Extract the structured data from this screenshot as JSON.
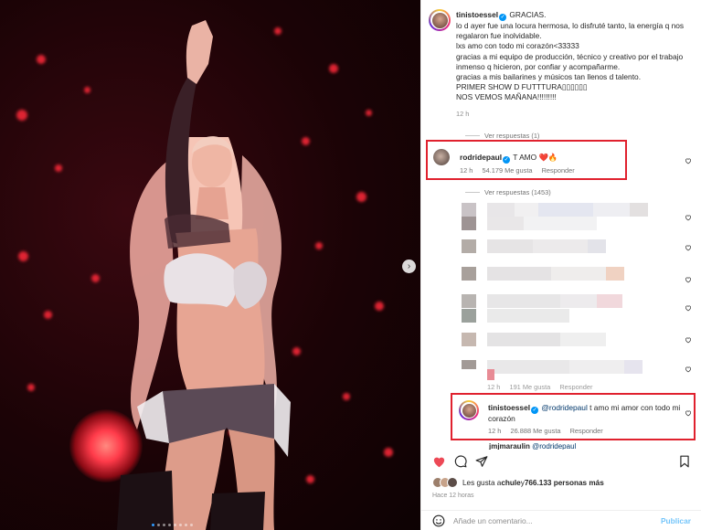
{
  "post": {
    "author": "tinistoessel",
    "verified": true,
    "caption_head": "GRACIAS.",
    "caption_lines": [
      "lo d ayer fue una locura hermosa, lo disfruté tanto, la energía q nos regalaron fue inolvidable.",
      "lxs amo con todo mi corazón<33333",
      "gracias a mi equipo de producción, técnico y creativo por el trabajo inmenso q hicieron, por confiar y acompañarme.",
      "gracias a mis bailarines y músicos tan llenos d talento.",
      "PRIMER SHOW D FUTTTURA▯▯▯▯▯▯",
      "NOS VEMOS MAÑANA!!!!!!!!!"
    ],
    "time": "12 h"
  },
  "comments": {
    "view_replies_1": "Ver respuestas (1)",
    "highlight_1": {
      "user": "rodridepaul",
      "text": "T AMO ❤️🔥",
      "time": "12 h",
      "likes": "54.179 Me gusta",
      "reply": "Responder"
    },
    "view_replies_2": "Ver respuestas (1453)",
    "partial_meta": {
      "time": "12 h",
      "likes": "191 Me gusta",
      "reply": "Responder"
    },
    "highlight_2": {
      "user": "tinistoessel",
      "mention": "@rodridepaul",
      "text": " t amo mi amor con todo mi corazón",
      "time": "12 h",
      "likes": "26.888 Me gusta",
      "reply": "Responder"
    },
    "partial_next": {
      "user": "jmjmaraulin",
      "mention": "@rodridepaul"
    }
  },
  "likes_summary": {
    "prefix": "Les gusta a ",
    "user": "chule",
    "middle": " y ",
    "count": "766.133 personas más"
  },
  "posted_ago": "Hace 12 horas",
  "comment_input": {
    "placeholder": "Añade un comentario..."
  },
  "publish_label": "Publicar",
  "colors": {
    "highlight_box": "#e0212e",
    "link": "#0095f6",
    "heart_red": "#ed4956"
  },
  "carousel": {
    "slides": 8,
    "active": 0
  }
}
